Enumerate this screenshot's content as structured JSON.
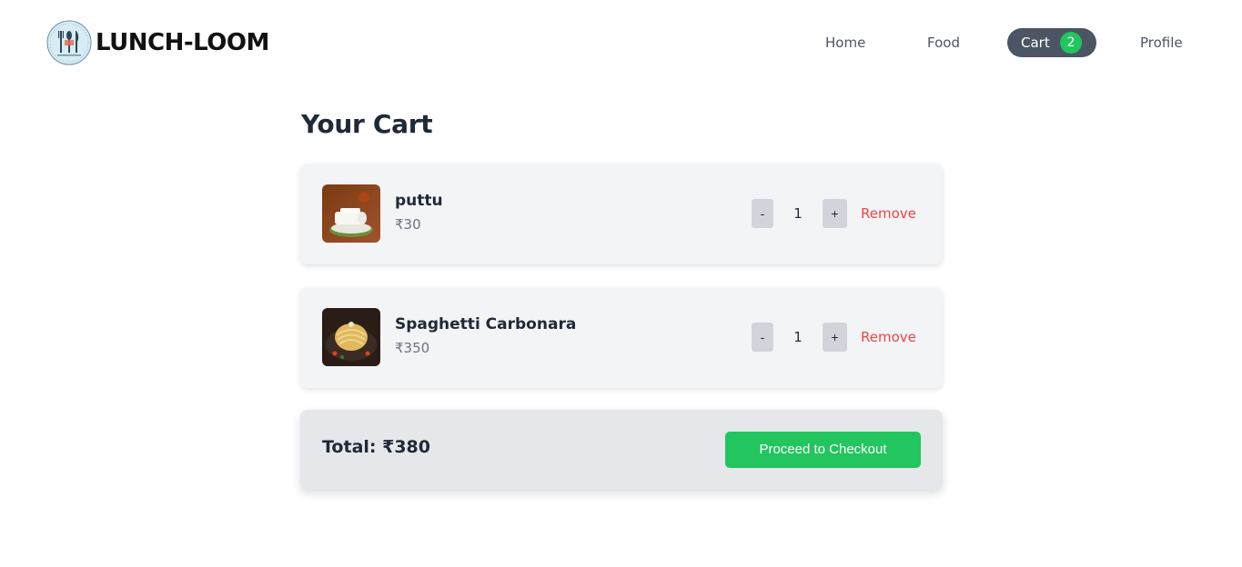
{
  "brand": {
    "name": "LUNCH-LOOM",
    "logo_icon": "fork-knife-logo-icon"
  },
  "nav": {
    "home": "Home",
    "food": "Food",
    "cart": "Cart",
    "cart_count": "2",
    "profile": "Profile"
  },
  "page": {
    "title": "Your Cart"
  },
  "cart": {
    "items": [
      {
        "name": "puttu",
        "price": "₹30",
        "quantity": "1",
        "dec_label": "-",
        "inc_label": "+",
        "remove_label": "Remove",
        "image": "puttu-food-image"
      },
      {
        "name": "Spaghetti Carbonara",
        "price": "₹350",
        "quantity": "1",
        "dec_label": "-",
        "inc_label": "+",
        "remove_label": "Remove",
        "image": "spaghetti-food-image"
      }
    ],
    "total_label": "Total: ₹380",
    "checkout_label": "Proceed to Checkout"
  },
  "colors": {
    "accent_green": "#22c55e",
    "nav_active_bg": "#4b5563",
    "remove_red": "#ef4444",
    "card_bg": "#f3f4f6"
  }
}
